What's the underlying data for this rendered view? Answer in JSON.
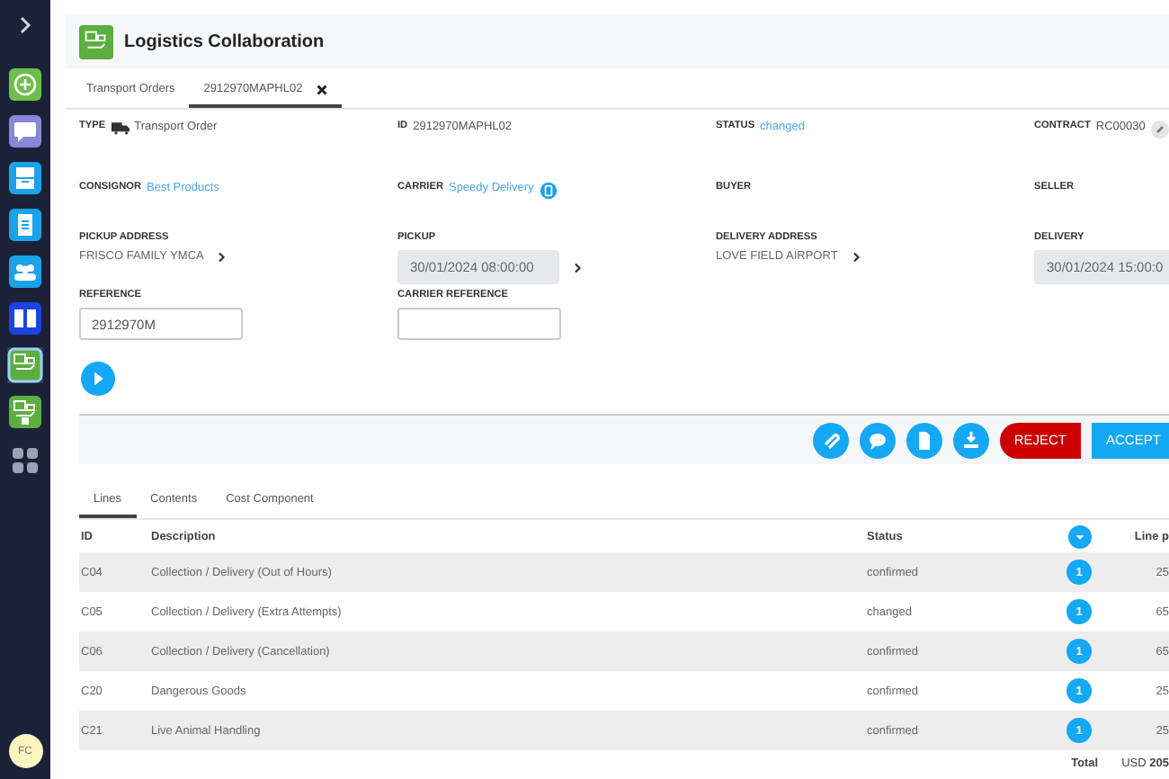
{
  "sidebar": {
    "items": [
      {
        "kind": "add",
        "selected": false
      },
      {
        "kind": "chat",
        "selected": false
      },
      {
        "kind": "inbox",
        "selected": false
      },
      {
        "kind": "clipboard",
        "selected": false
      },
      {
        "kind": "people",
        "selected": false
      },
      {
        "kind": "book",
        "selected": false
      },
      {
        "kind": "logistics",
        "selected": true
      },
      {
        "kind": "logistics-doc",
        "selected": false
      },
      {
        "kind": "apps",
        "selected": false
      }
    ],
    "avatar": "FC"
  },
  "header": {
    "title": "Logistics Collaboration"
  },
  "tabs": [
    {
      "label": "Transport Orders",
      "selected": false
    },
    {
      "label": "2912970MAPHL02",
      "selected": true
    }
  ],
  "fields": [
    {
      "kind": "type",
      "label": "TYPE",
      "value": "Transport Order"
    },
    {
      "kind": "plain",
      "label": "ID",
      "value": "2912970MAPHL02"
    },
    {
      "kind": "link",
      "label": "STATUS",
      "value": "changed"
    },
    {
      "kind": "contract",
      "label": "CONTRACT",
      "value": "RC00030"
    },
    {
      "kind": "link",
      "label": "CONSIGNOR",
      "value": "Best Products"
    },
    {
      "kind": "carrier",
      "label": "CARRIER",
      "value": "Speedy Delivery"
    },
    {
      "kind": "plain",
      "label": "BUYER"
    },
    {
      "kind": "plain",
      "label": "SELLER"
    },
    {
      "kind": "address",
      "label": "PICKUP ADDRESS",
      "value": "FRISCO FAMILY YMCA"
    },
    {
      "kind": "schedule",
      "label": "PICKUP",
      "value": "30/01/2024 08:00:00"
    },
    {
      "kind": "address",
      "label": "DELIVERY ADDRESS",
      "value": "LOVE FIELD AIRPORT"
    },
    {
      "kind": "datetime",
      "label": "DELIVERY",
      "value": "30/01/2024 15:00:0"
    },
    {
      "kind": "input",
      "label": "REFERENCE",
      "value": "2912970M"
    },
    {
      "kind": "input",
      "label": "CARRIER REFERENCE"
    }
  ],
  "toolbar": {
    "icons": [
      {
        "kind": "attach"
      },
      {
        "kind": "comment"
      },
      {
        "kind": "document"
      },
      {
        "kind": "download"
      }
    ],
    "buttons": [
      {
        "label": "REJECT",
        "kind": "danger"
      },
      {
        "label": "ACCEPT",
        "kind": "primary"
      }
    ]
  },
  "subtabs": [
    {
      "label": "Lines",
      "selected": true
    },
    {
      "label": "Contents",
      "selected": false
    },
    {
      "label": "Cost Component",
      "selected": false
    }
  ],
  "table": {
    "columns": [
      "ID",
      "Description",
      "Status",
      "Line p"
    ],
    "rows": [
      {
        "id": "C04",
        "description": "Collection / Delivery (Out of Hours)",
        "status": "confirmed",
        "count": "1",
        "price": "25"
      },
      {
        "id": "C05",
        "description": "Collection / Delivery (Extra Attempts)",
        "status": "changed",
        "count": "1",
        "price": "65"
      },
      {
        "id": "C06",
        "description": "Collection / Delivery (Cancellation)",
        "status": "confirmed",
        "count": "1",
        "price": "65"
      },
      {
        "id": "C20",
        "description": "Dangerous Goods",
        "status": "confirmed",
        "count": "1",
        "price": "25"
      },
      {
        "id": "C21",
        "description": "Live Animal Handling",
        "status": "confirmed",
        "count": "1",
        "price": "25"
      }
    ],
    "total_label": "Total",
    "total_value": "USD **205**"
  }
}
